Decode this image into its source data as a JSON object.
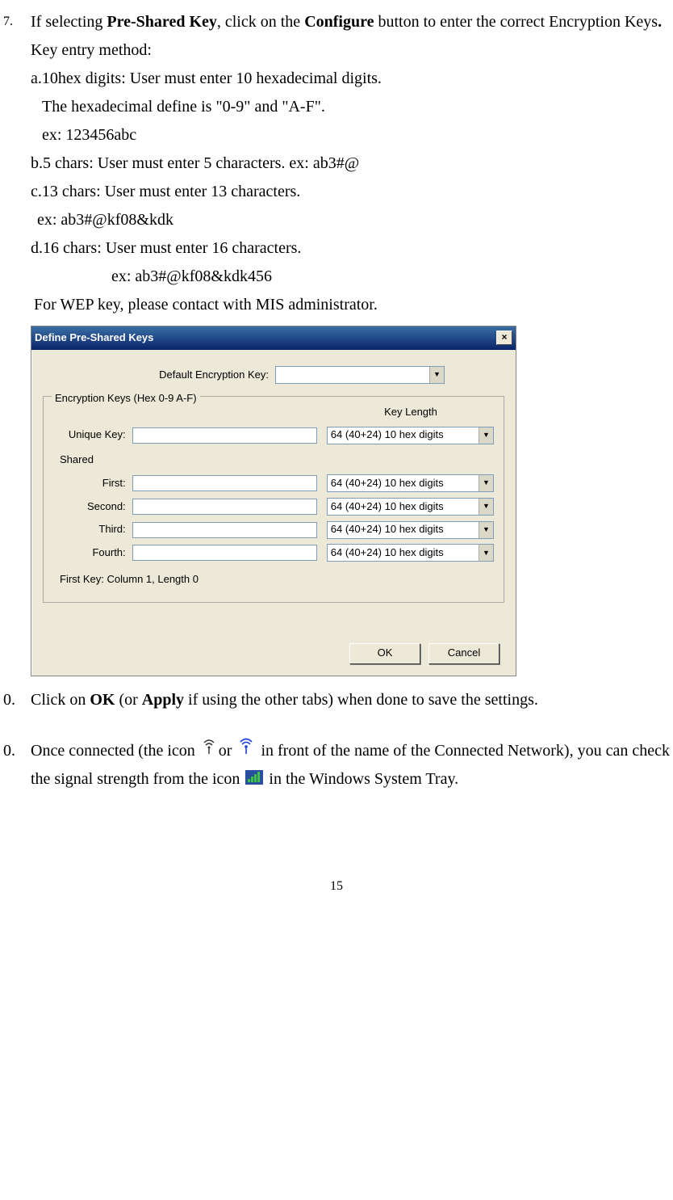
{
  "step7": {
    "num": "7.",
    "line1_a": "If selecting ",
    "line1_b": "Pre-Shared Key",
    "line1_c": ", click on the ",
    "line1_d": "Configure",
    "line1_e": " button to enter the correct Encryption Keys",
    "line1_f": ".",
    "line2": "Key entry method:",
    "a": "a.10hex digits: User must enter 10 hexadecimal digits.",
    "a_sub1": "The hexadecimal define is \"0-9\" and \"A-F\".",
    "a_sub2": "ex: 123456abc",
    "b": "b.5 chars: User must enter 5 characters. ex: ab3#@",
    "c": "c.13 chars: User must enter 13 characters.",
    "c_sub": "ex: ab3#@kf08&kdk",
    "d": "d.16 chars: User must enter 16 characters.",
    "d_sub": "ex: ab3#@kf08&kdk456",
    "wep": "For WEP key, please contact with MIS administrator."
  },
  "dialog": {
    "title": "Define Pre-Shared Keys",
    "close": "×",
    "default_label": "Default Encryption Key:",
    "default_value": "",
    "fieldset_title": "Encryption Keys (Hex 0-9 A-F)",
    "key_length_hdr": "Key Length",
    "unique_label": "Unique Key:",
    "shared_label": "Shared",
    "rows": [
      {
        "label": "First:"
      },
      {
        "label": "Second:"
      },
      {
        "label": "Third:"
      },
      {
        "label": "Fourth:"
      }
    ],
    "select_text": "64  (40+24)  10 hex digits",
    "status": "First Key: Column 1,  Length 0",
    "ok": "OK",
    "cancel": "Cancel"
  },
  "step0a": {
    "num": "0.",
    "a": "Click on ",
    "b": "OK",
    "c": " (or ",
    "d": "Apply",
    "e": " if using the other tabs) when done to save the settings."
  },
  "step0b": {
    "num": "0.",
    "a": "Once connected (the icon ",
    "b": "or ",
    "c": " in front of the name of the Connected Network), you can check the signal strength from the icon ",
    "d": " in the Windows System Tray."
  },
  "page_num": "15"
}
